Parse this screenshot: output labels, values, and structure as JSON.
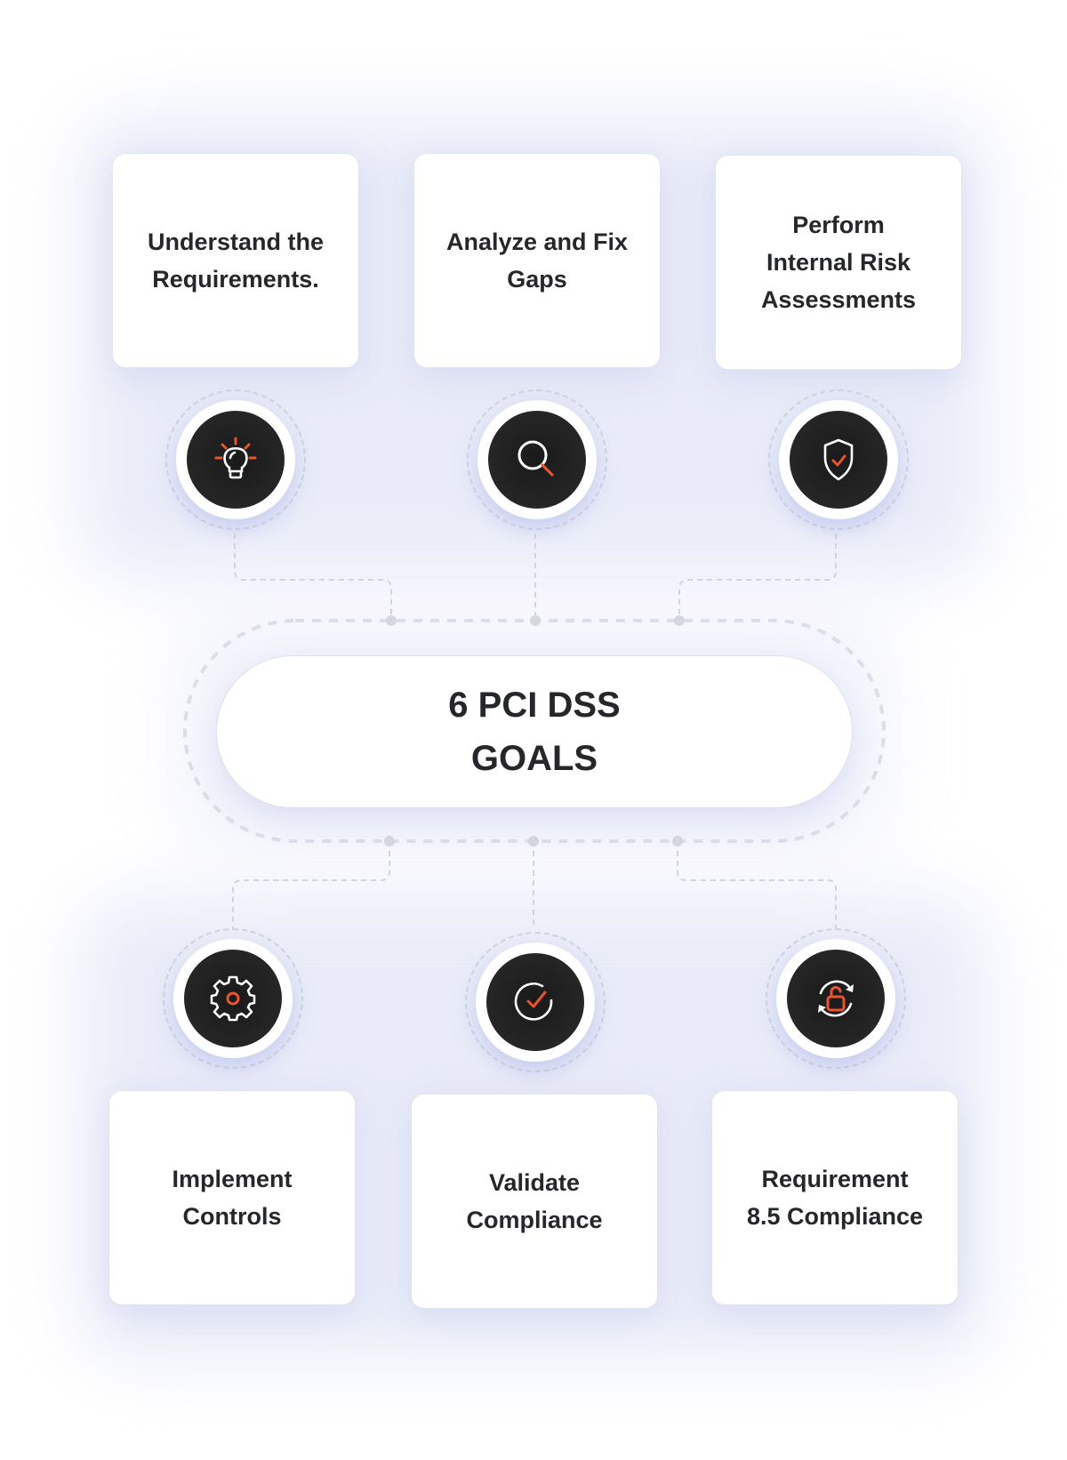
{
  "center": {
    "title": "6 PCI DSS\nGOALS"
  },
  "colors": {
    "accent": "#e8552d",
    "icon_bg": "#222222",
    "text": "#26272b",
    "connector": "#cfd2de"
  },
  "top_goals": [
    {
      "label": "Understand the\nRequirements.",
      "icon": "lightbulb-icon"
    },
    {
      "label": "Analyze and Fix\nGaps",
      "icon": "magnifier-icon"
    },
    {
      "label": "Perform\nInternal Risk\nAssessments",
      "icon": "shield-check-icon"
    }
  ],
  "bottom_goals": [
    {
      "label": "Implement\nControls",
      "icon": "gear-icon"
    },
    {
      "label": "Validate\nCompliance",
      "icon": "circle-check-icon"
    },
    {
      "label": "Requirement\n8.5 Compliance",
      "icon": "unlock-refresh-icon"
    }
  ]
}
